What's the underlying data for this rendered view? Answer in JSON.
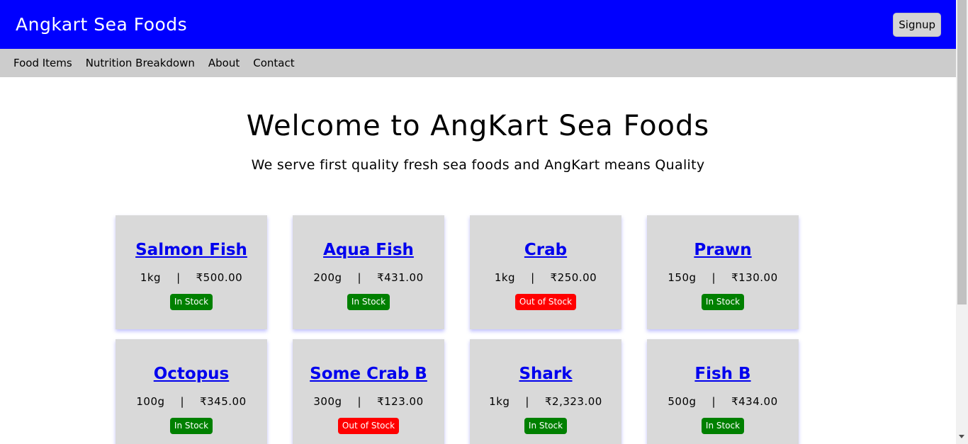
{
  "header": {
    "brand": "Angkart Sea Foods",
    "signup_label": "Signup"
  },
  "nav": {
    "items": [
      "Food Items",
      "Nutrition Breakdown",
      "About",
      "Contact"
    ]
  },
  "hero": {
    "title": "Welcome to AngKart Sea Foods",
    "subtitle": "We serve first quality fresh sea foods and AngKart means Quality"
  },
  "products": [
    {
      "name": "Salmon Fish",
      "weight": "1kg",
      "price": "₹500.00",
      "status": "In Stock"
    },
    {
      "name": "Aqua Fish",
      "weight": "200g",
      "price": "₹431.00",
      "status": "In Stock"
    },
    {
      "name": "Crab",
      "weight": "1kg",
      "price": "₹250.00",
      "status": "Out of Stock"
    },
    {
      "name": "Prawn",
      "weight": "150g",
      "price": "₹130.00",
      "status": "In Stock"
    },
    {
      "name": "Octopus",
      "weight": "100g",
      "price": "₹345.00",
      "status": "In Stock"
    },
    {
      "name": "Some Crab B",
      "weight": "300g",
      "price": "₹123.00",
      "status": "Out of Stock"
    },
    {
      "name": "Shark",
      "weight": "1kg",
      "price": "₹2,323.00",
      "status": "In Stock"
    },
    {
      "name": "Fish B",
      "weight": "500g",
      "price": "₹434.00",
      "status": "In Stock"
    }
  ],
  "separator": "|",
  "colors": {
    "header_bg": "#0000ff",
    "nav_bg": "#cccccc",
    "card_bg": "#d9d9d9",
    "link": "#0000ee",
    "in_stock": "#008000",
    "out_of_stock": "#ff0000"
  }
}
